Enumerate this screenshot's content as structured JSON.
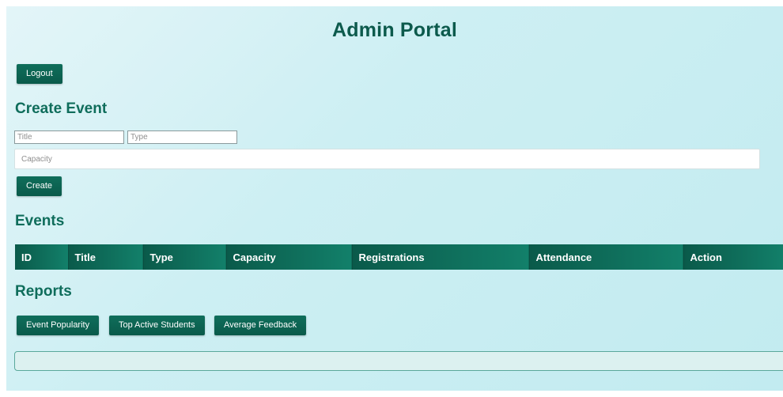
{
  "header": {
    "title": "Admin Portal"
  },
  "actions": {
    "logout_label": "Logout"
  },
  "create_event": {
    "heading": "Create Event",
    "title_placeholder": "Title",
    "type_placeholder": "Type",
    "capacity_placeholder": "Capacity",
    "create_label": "Create"
  },
  "events": {
    "heading": "Events",
    "columns": [
      "ID",
      "Title",
      "Type",
      "Capacity",
      "Registrations",
      "Attendance",
      "Action"
    ]
  },
  "reports": {
    "heading": "Reports",
    "buttons": [
      "Event Popularity",
      "Top Active Students",
      "Average Feedback"
    ]
  },
  "colors": {
    "primary": "#0f6e5b",
    "heading": "#0c5a4c",
    "background": "#cdeff3"
  }
}
